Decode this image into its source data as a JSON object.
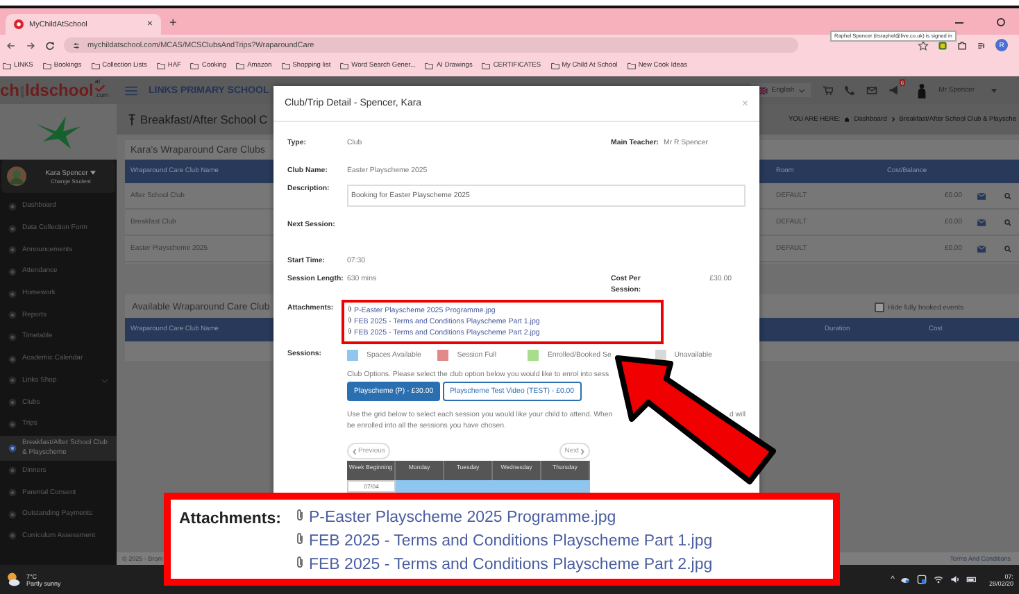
{
  "browser": {
    "tab": {
      "title": "MyChildAtSchool",
      "close": "×"
    },
    "new_tab": "+",
    "url": "mychildatschool.com/MCAS/MCSClubsAndTrips?WraparoundCare",
    "profile": "R",
    "tooltip": "Raphel Spencer (itsraphel@live.co.uk) is signed in",
    "bookmarks": [
      "LINKS",
      "Bookings",
      "Collection Lists",
      "HAF",
      "Cooking",
      "Amazon",
      "Shopping list",
      "Word Search Gener...",
      "AI Drawings",
      "CERTIFICATES",
      "My Child At School",
      "New Cook Ideas"
    ]
  },
  "header": {
    "logo": {
      "left": "ch",
      "right": "ldschool",
      "sup": "at",
      "suffix": ".com"
    },
    "school_name": "LINKS PRIMARY SCHOOL",
    "language": "English",
    "notification_count": "6",
    "user": "Mr Spencer"
  },
  "sidebar": {
    "student": {
      "name": "Kara Spencer",
      "action": "Change Student"
    },
    "items": [
      {
        "label": "Dashboard",
        "selected": false,
        "has_submenu": false
      },
      {
        "label": "Data Collection Form",
        "selected": false,
        "has_submenu": false
      },
      {
        "label": "Announcements",
        "selected": false,
        "has_submenu": false
      },
      {
        "label": "Attendance",
        "selected": false,
        "has_submenu": false
      },
      {
        "label": "Homework",
        "selected": false,
        "has_submenu": false
      },
      {
        "label": "Reports",
        "selected": false,
        "has_submenu": false
      },
      {
        "label": "Timetable",
        "selected": false,
        "has_submenu": false
      },
      {
        "label": "Academic Calendar",
        "selected": false,
        "has_submenu": false
      },
      {
        "label": "Links Shop",
        "selected": false,
        "has_submenu": true
      },
      {
        "label": "Clubs",
        "selected": false,
        "has_submenu": false
      },
      {
        "label": "Trips",
        "selected": false,
        "has_submenu": false
      },
      {
        "label": "Breakfast/After School Club & Playscheme",
        "selected": true,
        "has_submenu": false
      },
      {
        "label": "Dinners",
        "selected": false,
        "has_submenu": false
      },
      {
        "label": "Parental Consent",
        "selected": false,
        "has_submenu": false
      },
      {
        "label": "Outstanding Payments",
        "selected": false,
        "has_submenu": false
      },
      {
        "label": "Curriculum Assessment",
        "selected": false,
        "has_submenu": false
      }
    ]
  },
  "page": {
    "title": "Breakfast/After School C",
    "breadcrumb": {
      "prefix": "YOU ARE HERE:",
      "items": [
        "Dashboard",
        "Breakfast/After School Club & Playsche"
      ]
    }
  },
  "my_clubs": {
    "title": "Kara's Wraparound Care Clubs",
    "columns": [
      "Wraparound Care Club Name",
      "Room",
      "Cost/Balance"
    ],
    "rows": [
      {
        "name": "After School Club",
        "room": "DEFAULT",
        "cost": "£0.00"
      },
      {
        "name": "Breakfast Club",
        "room": "DEFAULT",
        "cost": "£0.00"
      },
      {
        "name": "Easter Playscheme 2025",
        "room": "DEFAULT",
        "cost": "£0.00"
      }
    ]
  },
  "available_clubs": {
    "title": "Available Wraparound Care Club",
    "hide_full": {
      "label": "Hide fully booked events",
      "checked": false
    },
    "columns": [
      "Wraparound Care Club Name",
      "Duration",
      "Cost"
    ]
  },
  "footer": {
    "left": "© 2025 - Brom",
    "right": "Terms And Conditions"
  },
  "modal": {
    "title": "Club/Trip Detail - Spencer, Kara",
    "close": "×",
    "type": {
      "label": "Type:",
      "value": "Club"
    },
    "teacher": {
      "label": "Main Teacher:",
      "value": "Mr R Spencer"
    },
    "club_name": {
      "label": "Club Name:",
      "value": "Easter Playscheme 2025"
    },
    "description": {
      "label": "Description:",
      "value": "Booking for Easter Playscheme 2025"
    },
    "next_session": {
      "label": "Next Session:"
    },
    "start_time": {
      "label": "Start Time:",
      "value": "07:30"
    },
    "session_length": {
      "label": "Session Length:",
      "value": "630 mins"
    },
    "cost": {
      "label": "Cost Per Session:",
      "value": "£30.00"
    },
    "attachments_label": "Attachments:",
    "attachments": [
      "P-Easter Playscheme 2025 Programme.jpg",
      "FEB 2025 - Terms and Conditions Playscheme Part 1.jpg",
      "FEB 2025 - Terms and Conditions Playscheme Part 2.jpg"
    ],
    "sessions_label": "Sessions:",
    "legend": [
      {
        "label": "Spaces Available",
        "color": "#8ec6ef"
      },
      {
        "label": "Session Full",
        "color": "#e28a8a"
      },
      {
        "label": "Enrolled/Booked Se",
        "color": "#a9dc8c"
      },
      {
        "label": "Unavailable",
        "color": "#d9d9d9"
      }
    ],
    "options_text": "Club Options. Please select the club option below you would like to enrol into sess",
    "options": [
      {
        "label": "Playscheme (P) - £30.00",
        "selected": true
      },
      {
        "label": "Playscheme Test Video (TEST) - £0.00",
        "selected": false
      }
    ],
    "grid_text": "Use the grid below to select each session you would like your child to attend. When",
    "grid_text_end": "d will",
    "grid_text_2": "be enrolled into all the sessions you have chosen.",
    "previous": "Previous",
    "next": "Next",
    "grid": {
      "columns": [
        "Week Beginning",
        "Monday",
        "Tuesday",
        "Wednesday",
        "Thursday"
      ],
      "rows": [
        {
          "week": "07/04",
          "cells": [
            {
              "color": "#8ec6ef"
            },
            {
              "color": "#8ec6ef"
            },
            {
              "color": "#8ec6ef"
            },
            {
              "color": "#8ec6ef"
            }
          ]
        }
      ]
    }
  },
  "callout": {
    "label": "Attachments:",
    "attachments": [
      "P-Easter Playscheme 2025 Programme.jpg",
      "FEB 2025 - Terms and Conditions Playscheme Part 1.jpg",
      "FEB 2025 - Terms and Conditions Playscheme Part 2.jpg"
    ]
  },
  "taskbar": {
    "temperature": "7°C",
    "weather": "Partly sunny",
    "tray_caret": "^",
    "time": "07:",
    "date": "28/02/20"
  }
}
